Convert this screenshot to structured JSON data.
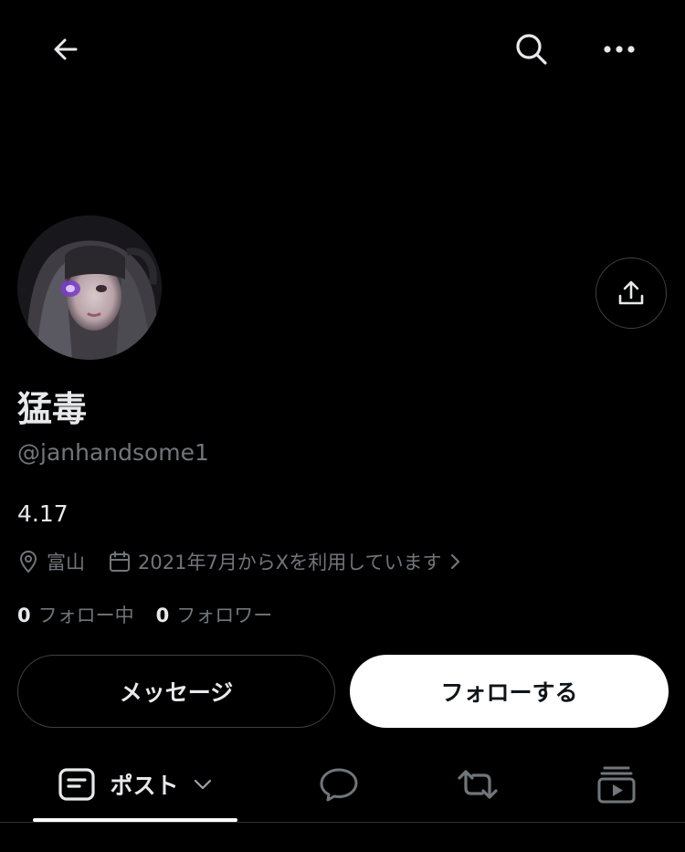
{
  "header": {
    "back_icon": "arrow-left-icon",
    "search_icon": "search-icon",
    "more_icon": "more-horizontal-icon"
  },
  "profile": {
    "display_name": "猛毒",
    "handle": "@janhandsome1",
    "bio": "4.17",
    "location": "富山",
    "joined": "2021年7月からXを利用しています",
    "following_count": "0",
    "following_label": "フォロー中",
    "followers_count": "0",
    "followers_label": "フォロワー"
  },
  "actions": {
    "share_icon": "share-upload-icon",
    "message_label": "メッセージ",
    "follow_label": "フォローする"
  },
  "tabs": {
    "posts_label": "ポスト",
    "posts_icon": "document-icon",
    "replies_icon": "speech-bubble-icon",
    "reposts_icon": "repost-icon",
    "media_icon": "media-play-icon"
  },
  "colors": {
    "background": "#000000",
    "primary_text": "#e7e9ea",
    "secondary_text": "#71767b",
    "border": "#3e4144",
    "follow_button_bg": "#ffffff",
    "follow_button_text": "#0f1419"
  }
}
